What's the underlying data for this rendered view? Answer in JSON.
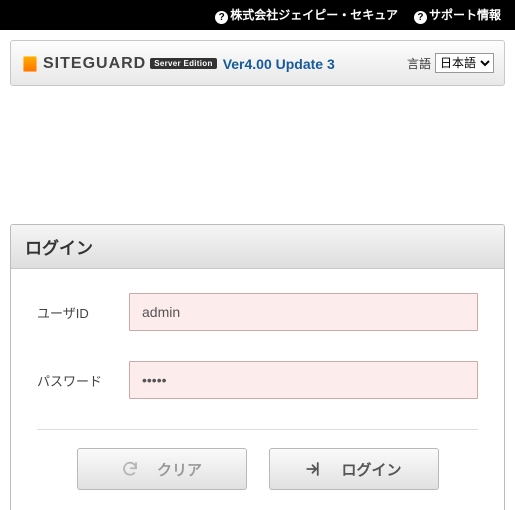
{
  "topnav": {
    "company_link": "株式会社ジェイピー・セキュア",
    "support_link": "サポート情報"
  },
  "header": {
    "brand_main": "SITEGUARD",
    "brand_badge": "Server Edition",
    "version": "Ver4.00 Update 3",
    "lang_label": "言語",
    "lang_selected": "日本語",
    "lang_options": [
      "日本語"
    ]
  },
  "login": {
    "title": "ログイン",
    "user_label": "ユーザID",
    "user_value": "admin",
    "pass_label": "パスワード",
    "pass_value": "•••••",
    "clear_btn": "クリア",
    "login_btn": "ログイン"
  },
  "colors": {
    "accent_orange": "#ff8a00",
    "link_blue": "#165a9a",
    "input_err_bg": "#fdecec",
    "input_err_border": "#cfa8a8"
  }
}
